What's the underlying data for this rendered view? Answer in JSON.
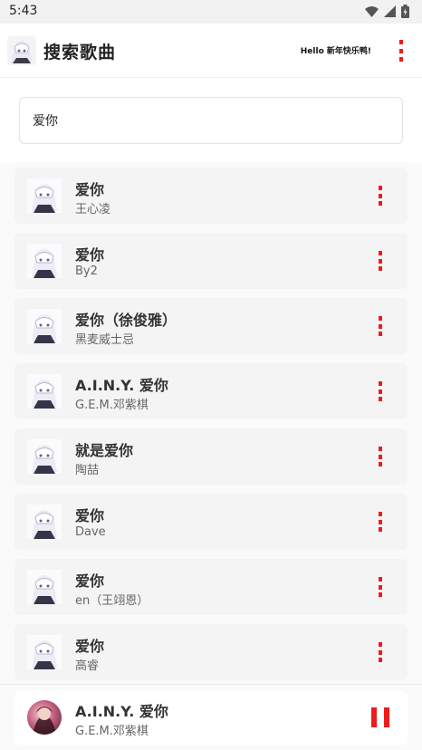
{
  "status": {
    "time": "5:43"
  },
  "app_bar": {
    "title": "搜索歌曲",
    "greeting": "Hello 新年快乐鸭!",
    "avatar_icon": "anime-avatar-icon",
    "menu_icon": "more-vertical-icon"
  },
  "search": {
    "value": "爱你",
    "placeholder": ""
  },
  "songs": [
    {
      "title": "爱你",
      "artist": "王心凌"
    },
    {
      "title": "爱你",
      "artist": "By2"
    },
    {
      "title": "爱你（徐俊雅）",
      "artist": "黑麦威士忌"
    },
    {
      "title": "A.I.N.Y. 爱你",
      "artist": "G.E.M.邓紫棋"
    },
    {
      "title": "就是爱你",
      "artist": "陶喆"
    },
    {
      "title": "爱你",
      "artist": "Dave"
    },
    {
      "title": "爱你",
      "artist": "en（王翊恩）"
    },
    {
      "title": "爱你",
      "artist": "高睿"
    }
  ],
  "player": {
    "title": "A.I.N.Y. 爱你",
    "artist": "G.E.M.邓紫棋",
    "state_icon": "pause-icon"
  },
  "colors": {
    "accent": "#ee1c1c",
    "card": "#f4f4f4",
    "list_bg": "#fafafa"
  }
}
